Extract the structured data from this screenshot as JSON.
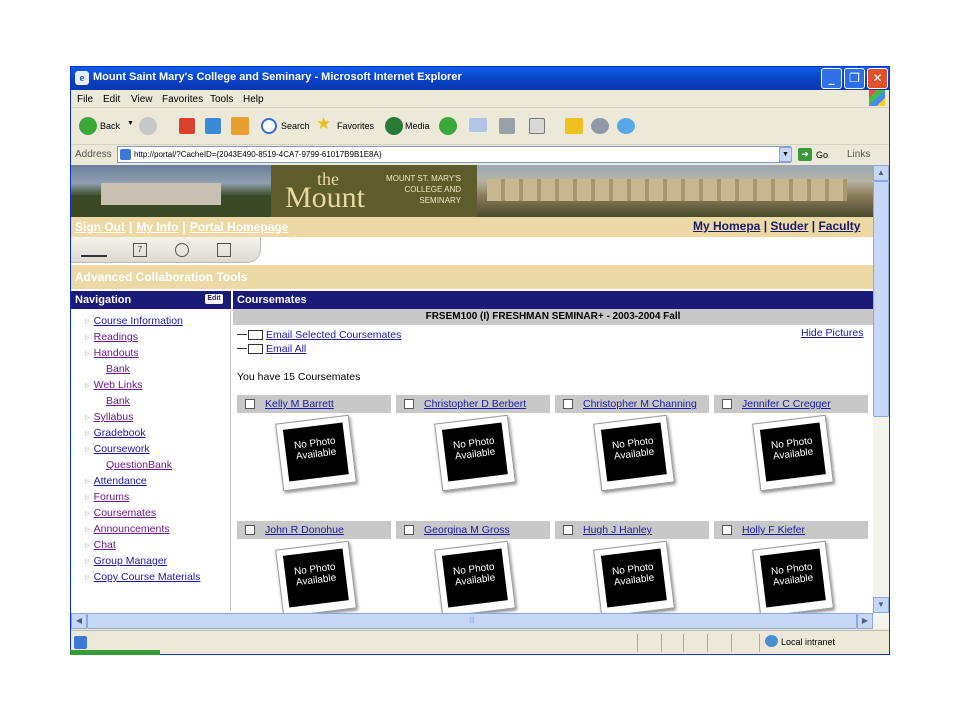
{
  "window": {
    "title": "Mount Saint Mary's College and Seminary - Microsoft Internet Explorer",
    "minimize": "_",
    "maximize": "❐",
    "close": "✕"
  },
  "menu": [
    "File",
    "Edit",
    "View",
    "Favorites",
    "Tools",
    "Help"
  ],
  "toolbar": {
    "back": "Back",
    "search": "Search",
    "favorites": "Favorites",
    "media": "Media"
  },
  "address": {
    "label": "Address",
    "url": "http://portal/?CacheID={2043E490-8519-4CA7-9799-61017B9B1E8A}",
    "go": "Go",
    "links": "Links"
  },
  "banner": {
    "the": "the",
    "mount": "Mount",
    "sub": "MOUNT ST. MARY'S COLLEGE AND SEMINARY"
  },
  "topnav": {
    "left": [
      "Sign Out",
      "My Info",
      "Portal Homepage"
    ],
    "right": [
      "My Homepa",
      "Studer",
      "Faculty"
    ]
  },
  "adv_title": "Advanced Collaboration Tools",
  "nav": {
    "title": "Navigation",
    "edit": "Edit",
    "items": [
      {
        "label": "Course Information",
        "sub": false,
        "visited": false
      },
      {
        "label": "Readings",
        "sub": false,
        "visited": true
      },
      {
        "label": "Handouts",
        "sub": false,
        "visited": true
      },
      {
        "label": "Bank",
        "sub": true,
        "visited": true
      },
      {
        "label": "Web Links",
        "sub": false,
        "visited": true
      },
      {
        "label": "Bank",
        "sub": true,
        "visited": true
      },
      {
        "label": "Syllabus",
        "sub": false,
        "visited": true
      },
      {
        "label": "Gradebook",
        "sub": false,
        "visited": false
      },
      {
        "label": "Coursework",
        "sub": false,
        "visited": false
      },
      {
        "label": "QuestionBank",
        "sub": true,
        "visited": true
      },
      {
        "label": "Attendance",
        "sub": false,
        "visited": false
      },
      {
        "label": "Forums",
        "sub": false,
        "visited": true
      },
      {
        "label": "Coursemates",
        "sub": false,
        "visited": true
      },
      {
        "label": "Announcements",
        "sub": false,
        "visited": true
      },
      {
        "label": "Chat",
        "sub": false,
        "visited": true
      },
      {
        "label": "Group Manager",
        "sub": false,
        "visited": false
      },
      {
        "label": "Copy Course Materials",
        "sub": false,
        "visited": false
      }
    ]
  },
  "coursemates": {
    "title": "Coursemates",
    "course": "FRSEM100 (I) FRESHMAN SEMINAR+ - 2003-2004 Fall",
    "email_selected": "Email Selected Coursemates",
    "email_all": "Email All",
    "hide_pictures": "Hide Pictures",
    "count_text": "You have 15 Coursemates",
    "photo_text": "No Photo Available",
    "people": [
      "Kelly M Barrett",
      "Christopher D Berbert",
      "Christopher M Channing",
      "Jennifer C Cregger",
      "John R Donohue",
      "Georgina M Gross",
      "Hugh J Hanley",
      "Holly F Kiefer"
    ]
  },
  "status": {
    "zone": "Local intranet"
  }
}
